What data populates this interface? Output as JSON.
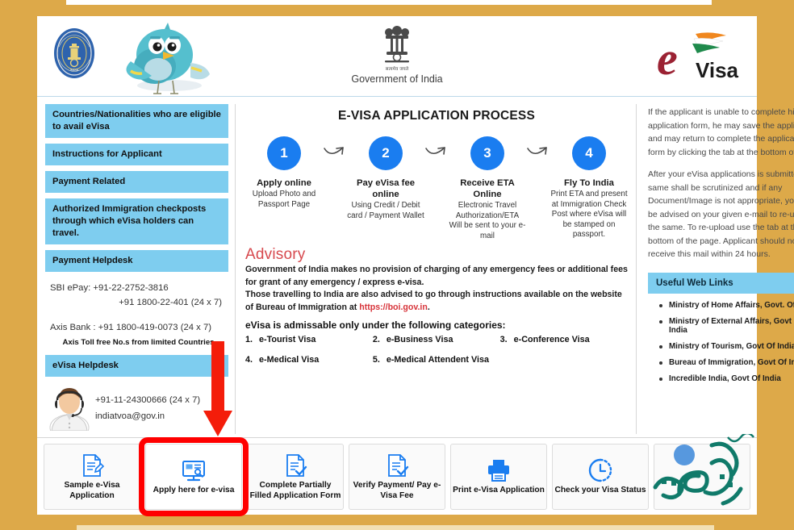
{
  "header": {
    "immigration_seal_alt": "Bureau of Immigration India seal",
    "mascot_alt": "blue bird mascot",
    "goi_hindi": "सत्यमेव जयते",
    "goi_label": "Government of India",
    "logo_e": "e",
    "logo_visa": "Visa"
  },
  "sidebar": {
    "items": [
      {
        "label": "Countries/Nationalities who are eligible to avail eVisa"
      },
      {
        "label": "Instructions for Applicant"
      },
      {
        "label": "Payment Related"
      },
      {
        "label": "Authorized Immigration checkposts through which eVisa holders can travel."
      },
      {
        "label": "Payment Helpdesk"
      }
    ],
    "payment_helpdesk": {
      "sbi_line": "SBI ePay: +91-22-2752-3816",
      "sbi_line2": "+91 1800-22-401 (24 x 7)",
      "axis_line": "Axis Bank : +91 1800-419-0073 (24 x 7)",
      "axis_note": "Axis Toll free No.s from limited Countries"
    },
    "evisa_helpdesk": {
      "title": "eVisa Helpdesk",
      "phone": "+91-11-24300666 (24 x 7)",
      "email": "indiatvoa@gov.in"
    }
  },
  "process": {
    "title": "E-VISA APPLICATION PROCESS",
    "steps": [
      {
        "number": "1",
        "title": "Apply online",
        "desc": "Upload Photo and Passport Page"
      },
      {
        "number": "2",
        "title": "Pay eVisa fee online",
        "desc": "Using Credit / Debit card / Payment Wallet"
      },
      {
        "number": "3",
        "title": "Receive ETA Online",
        "desc": "Electronic Travel Authorization/ETA Will be sent to your e-mail"
      },
      {
        "number": "4",
        "title": "Fly To India",
        "desc": "Print ETA and present at Immigration Check Post where eVisa will be stamped on passport."
      }
    ]
  },
  "advisory": {
    "title": "Advisory",
    "para1": "Government of India makes no provision of charging of any emergency fees or additional fees for grant of any emergency / express e-visa.",
    "para2_pre": "Those travelling to India are also advised to go through instructions available on the website of Bureau of Immigration at ",
    "para2_link": "https://boi.gov.in",
    "para2_post": ".",
    "categories_head": "eVisa is admissable only under the following categories:",
    "categories": [
      {
        "num": "1.",
        "label": "e-Tourist Visa"
      },
      {
        "num": "2.",
        "label": "e-Business Visa"
      },
      {
        "num": "3.",
        "label": "e-Conference Visa"
      },
      {
        "num": "4.",
        "label": "e-Medical Visa"
      },
      {
        "num": "5.",
        "label": "e-Medical Attendent Visa"
      }
    ]
  },
  "right_panel": {
    "para1": "If the applicant is unable to complete his e-visa application form, he may save the application and may return to complete the application form by clicking the tab at the bottom of page:",
    "para2": "After your eVisa applications is submitted, the same shall be scrutinized and if any Document/Image is not appropriate, you may be advised on your given e-mail to re-upload the same. To re-upload use the tab at the bottom of the page. Applicant should normally receive this mail within 24 hours.",
    "links_title": "Useful Web Links",
    "links": [
      "Ministry of Home Affairs, Govt. Of India.",
      "Ministry of External Affairs, Govt Of India",
      "Ministry of Tourism, Govt Of India",
      "Bureau of Immigration, Govt Of India",
      "Incredible India, Govt Of India"
    ]
  },
  "bottom_bar": {
    "tiles": [
      {
        "label": "Sample e-Visa Application",
        "icon": "document-pencil-icon",
        "highlighted": false
      },
      {
        "label": "Apply here for e-visa",
        "icon": "monitor-apply-icon",
        "highlighted": true
      },
      {
        "label": "Complete Partially Filled Application Form",
        "icon": "document-check-icon",
        "highlighted": false
      },
      {
        "label": "Verify Payment/ Pay e-Visa Fee",
        "icon": "document-download-icon",
        "highlighted": false
      },
      {
        "label": "Print e-Visa Application",
        "icon": "printer-icon",
        "highlighted": false
      },
      {
        "label": "Check your Visa Status",
        "icon": "clock-icon",
        "highlighted": false
      },
      {
        "label": "",
        "icon": "calligraphy-decoration",
        "highlighted": false
      }
    ]
  },
  "annotations": {
    "red_arrow": "red-down-arrow-pointing-to-apply-tile",
    "red_box": "red-highlight-box-around-apply-tile"
  },
  "colors": {
    "page_background": "#dda949",
    "sidebar_heading": "#7ecdef",
    "step_circle": "#1a7df0",
    "advisory_title": "#d7494e",
    "link_red": "#d7343a",
    "highlight_red": "#ff0000",
    "calligraphy_teal": "#107a6a"
  }
}
